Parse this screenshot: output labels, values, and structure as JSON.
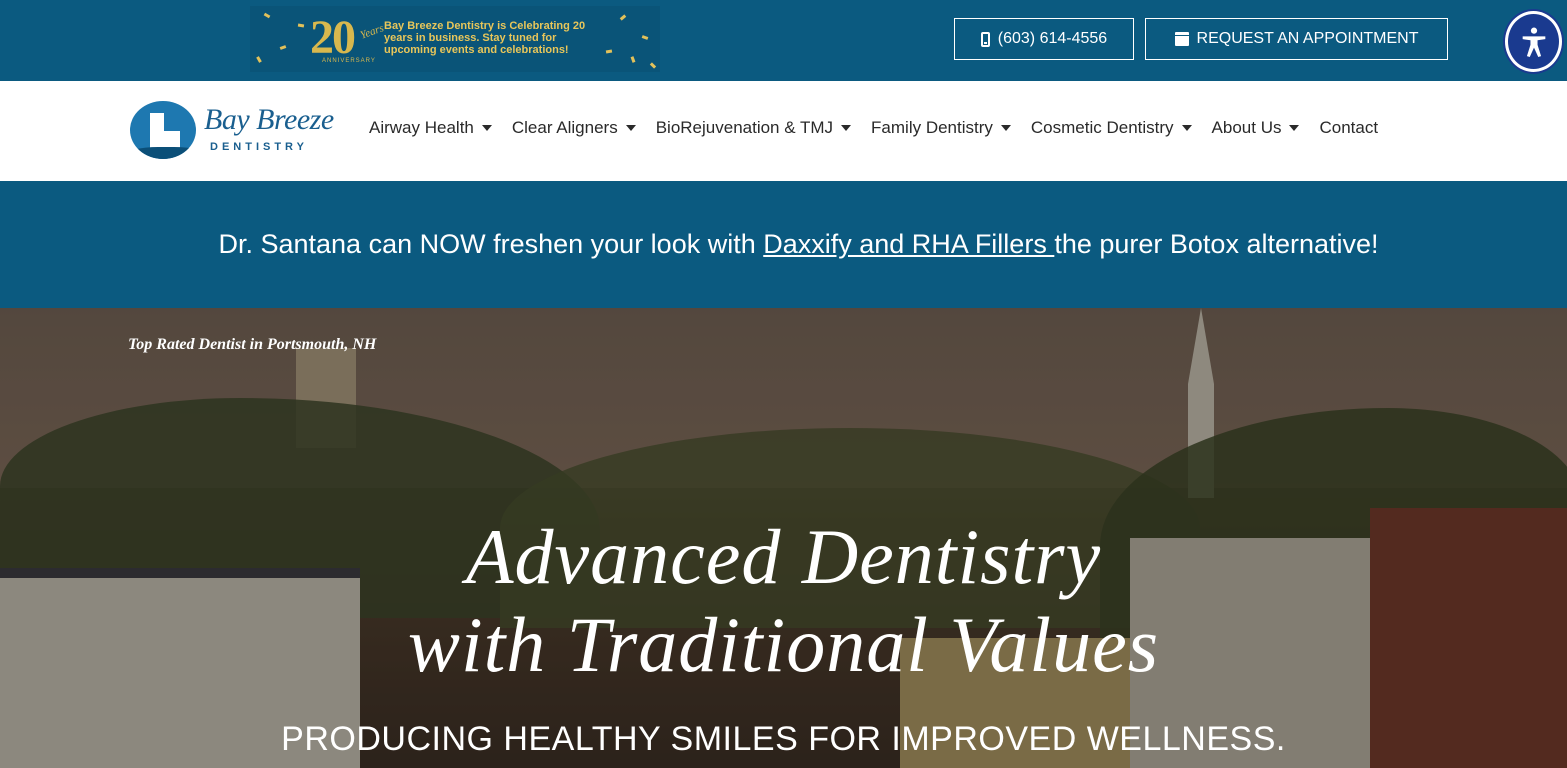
{
  "topbar": {
    "anniversary": {
      "number": "20",
      "script": "Years",
      "small": "ANNIVERSARY",
      "text": "Bay Breeze Dentistry is Celebrating 20 years in business. Stay tuned for upcoming events and celebrations!"
    },
    "phone_label": "(603) 614-4556",
    "appointment_label": "REQUEST AN APPOINTMENT"
  },
  "logo": {
    "name": "Bay Breeze",
    "sub": "DENTISTRY"
  },
  "nav": {
    "items": [
      {
        "label": "Airway Health"
      },
      {
        "label": "Clear Aligners"
      },
      {
        "label": "BioRejuvenation & TMJ"
      },
      {
        "label": "Family Dentistry"
      },
      {
        "label": "Cosmetic Dentistry"
      },
      {
        "label": "About Us"
      },
      {
        "label": "Contact"
      }
    ]
  },
  "promo": {
    "before": "Dr. Santana can NOW freshen your look with ",
    "link": "Daxxify and RHA Fillers ",
    "after": "the purer Botox alternative!"
  },
  "hero": {
    "tagline": "Top Rated Dentist in Portsmouth, NH",
    "headline_line1": "Advanced Dentistry",
    "headline_line2": "with Traditional Values",
    "subheading": "PRODUCING HEALTHY SMILES FOR IMPROVED WELLNESS."
  },
  "colors": {
    "brand_blue": "#0b5a80",
    "gold": "#d8b84e",
    "accessibility_blue": "#1a3a8f"
  },
  "icons": {
    "phone": "phone-icon",
    "calendar": "calendar-icon",
    "accessibility": "accessibility-icon",
    "dropdown": "chevron-down-icon"
  }
}
